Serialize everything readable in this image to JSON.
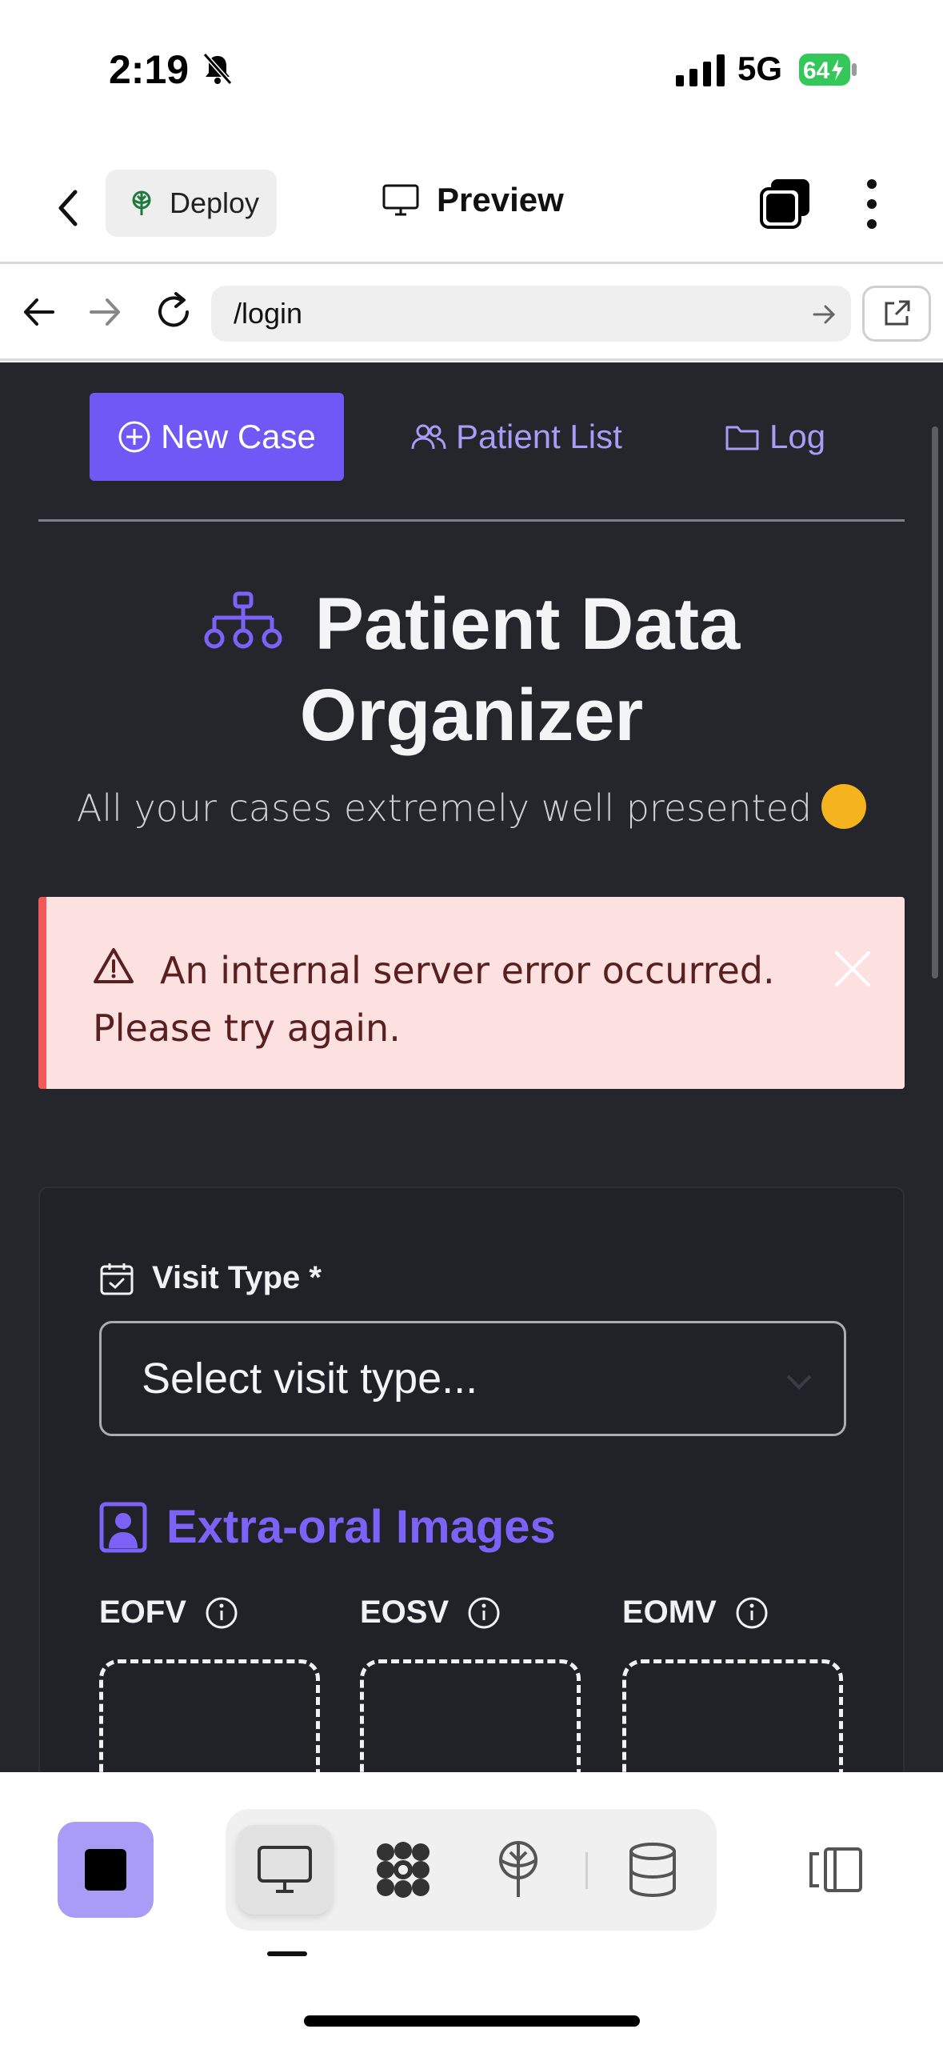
{
  "status": {
    "time": "2:19",
    "network": "5G",
    "battery": "64"
  },
  "app_bar": {
    "deploy_label": "Deploy",
    "preview_label": "Preview"
  },
  "browser": {
    "url": "/login"
  },
  "nav": {
    "new_case": "New Case",
    "patient_list": "Patient List",
    "log": "Log"
  },
  "header": {
    "title_line1": "Patient Data",
    "title_line2": "Organizer",
    "subtitle": "All your cases extremely well presented"
  },
  "alert": {
    "message": "An internal server error occurred. Please try again."
  },
  "form": {
    "visit_type_label": "Visit Type *",
    "visit_type_placeholder": "Select visit type...",
    "section_title": "Extra-oral Images",
    "images": [
      {
        "label": "EOFV"
      },
      {
        "label": "EOSV"
      },
      {
        "label": "EOMV"
      }
    ]
  },
  "colors": {
    "accent": "#6f58f5",
    "accent_light": "#a99cf7",
    "app_bg": "#24262b",
    "alert_bg": "#fde0e0",
    "alert_border": "#f25a5a"
  }
}
